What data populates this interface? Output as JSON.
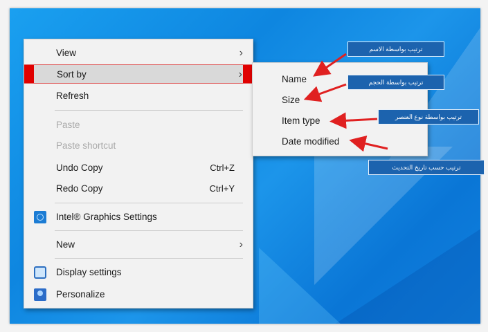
{
  "context_menu": {
    "items": [
      {
        "label": "View",
        "has_submenu": true
      },
      {
        "label": "Sort by",
        "has_submenu": true,
        "highlighted": true
      },
      {
        "label": "Refresh"
      },
      {
        "label": "Paste",
        "disabled": true
      },
      {
        "label": "Paste shortcut",
        "disabled": true
      },
      {
        "label": "Undo Copy",
        "accel": "Ctrl+Z"
      },
      {
        "label": "Redo Copy",
        "accel": "Ctrl+Y"
      },
      {
        "label": "Intel® Graphics Settings",
        "icon": "intel-graphics-icon"
      },
      {
        "label": "New",
        "has_submenu": true
      },
      {
        "label": "Display settings",
        "icon": "display-settings-icon"
      },
      {
        "label": "Personalize",
        "icon": "personalize-icon"
      }
    ]
  },
  "sort_submenu": {
    "items": [
      {
        "label": "Name"
      },
      {
        "label": "Size"
      },
      {
        "label": "Item type"
      },
      {
        "label": "Date modified"
      }
    ]
  },
  "annotations": {
    "name": "ترتيب بواسطة الاسم",
    "size": "ترتيب بواسطة الحجم",
    "item_type": "ترتيب بواسطة نوع العنصر",
    "date_modified": "ترتيب حسب تاريخ التحديث"
  },
  "colors": {
    "desktop": "#0e86e0",
    "menu_background": "#f2f2f2",
    "highlight": "#d9d9d9",
    "marker": "#e00000",
    "callout": "#1c63ae",
    "arrow": "#e02020"
  }
}
